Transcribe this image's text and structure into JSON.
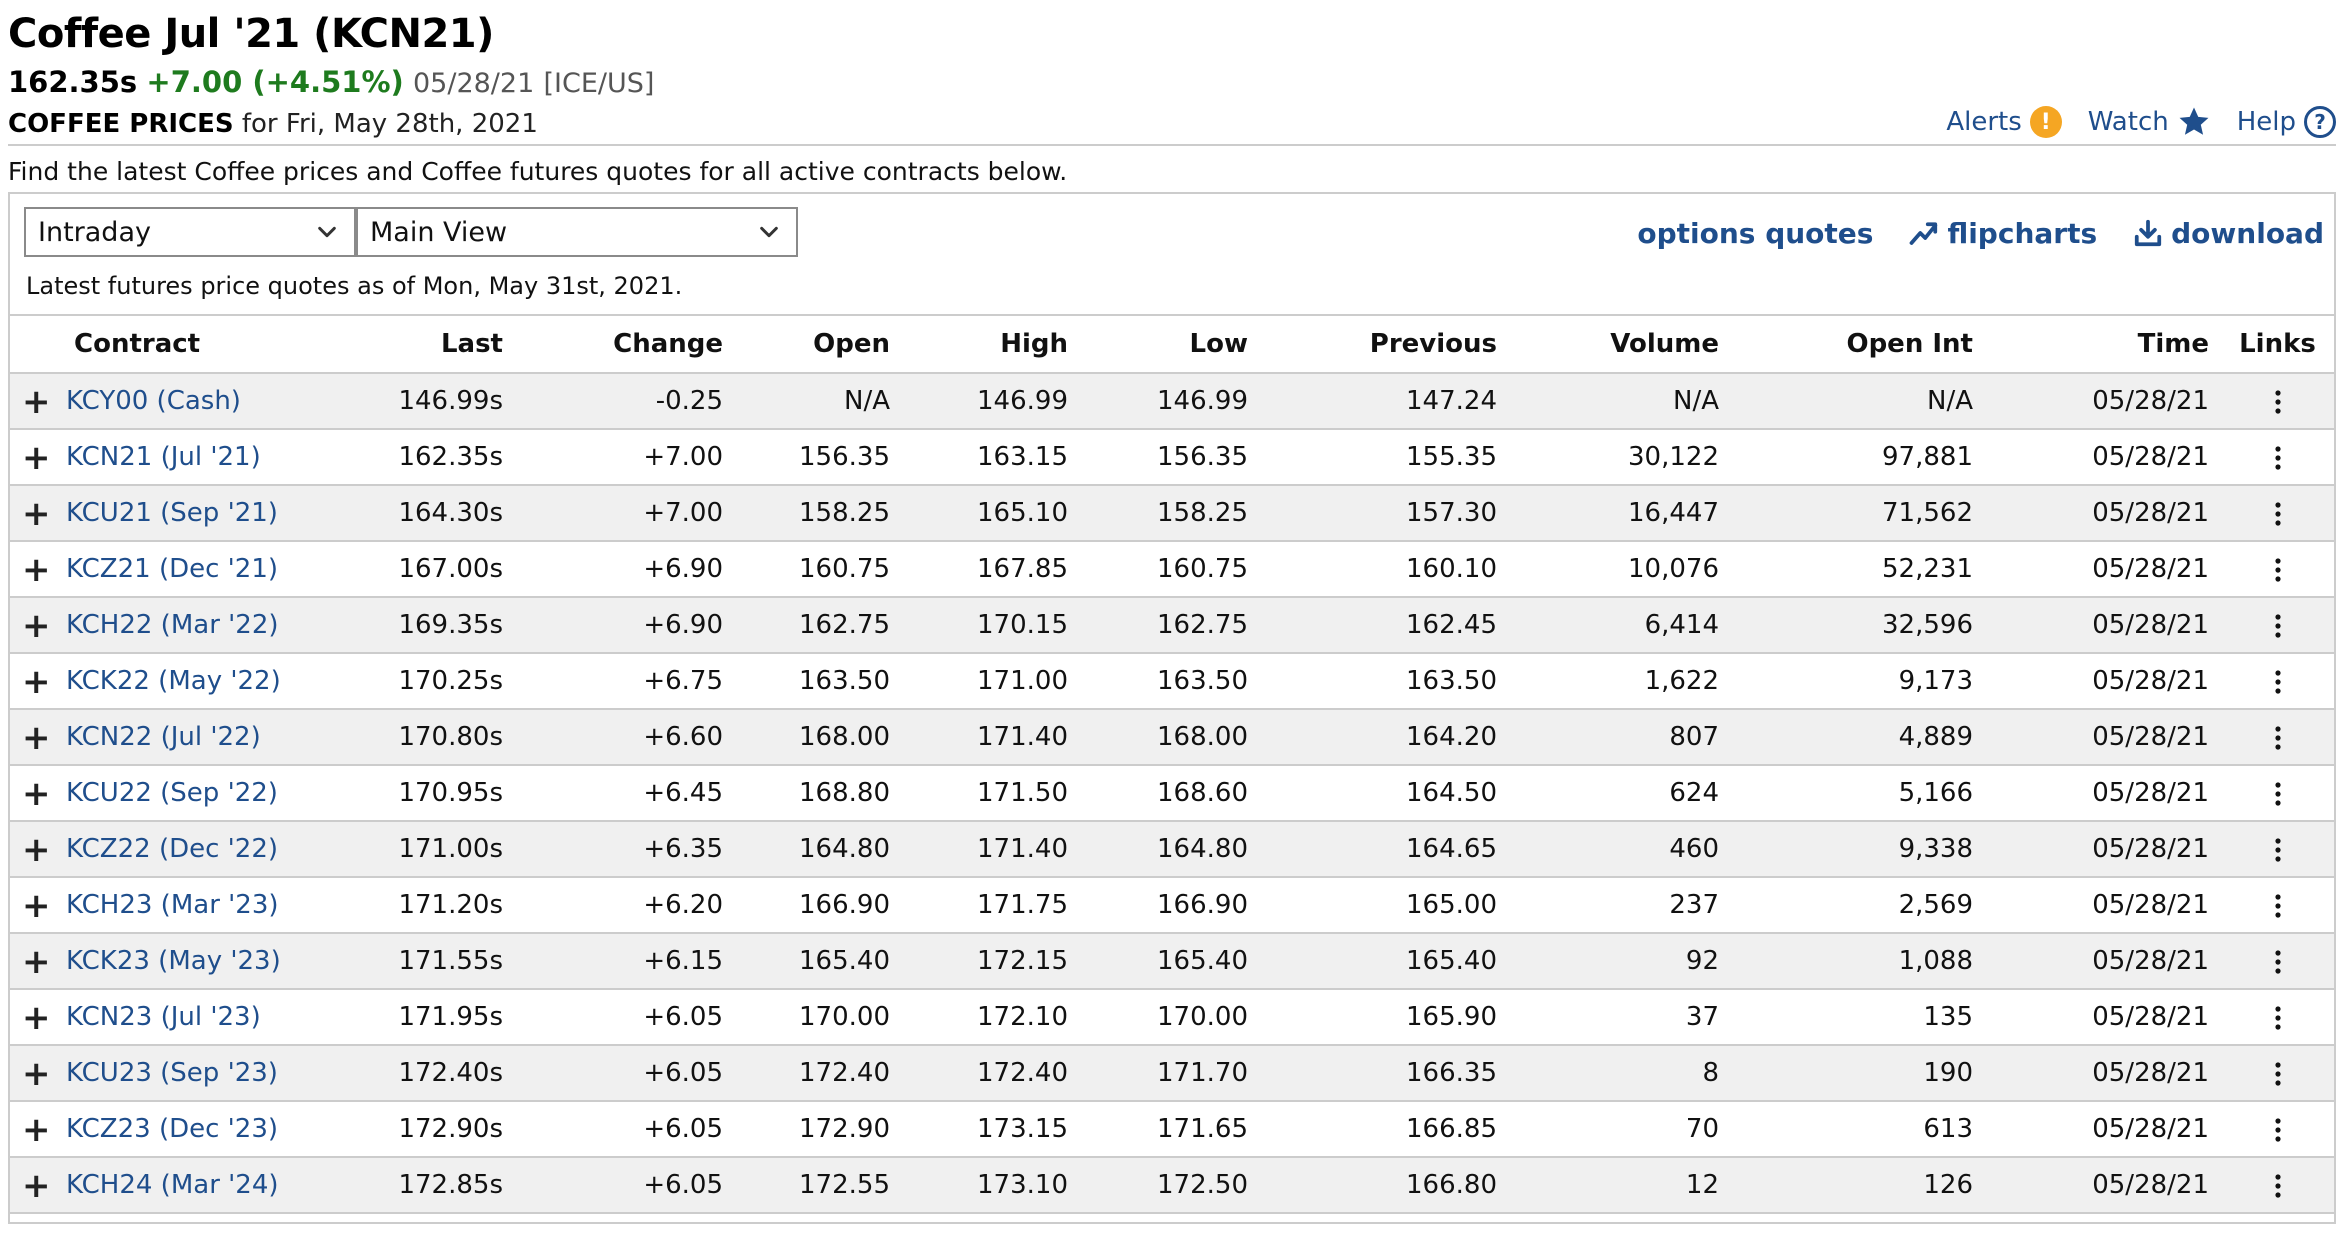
{
  "header": {
    "title": "Coffee Jul '21 (KCN21)",
    "last": "162.35s",
    "change": "+7.00 (+4.51%)",
    "date": "05/28/21",
    "exchange": "[ICE/US]",
    "subtitle_label": "COFFEE PRICES",
    "subtitle_rest": "for Fri, May 28th, 2021"
  },
  "top_links": {
    "alerts": "Alerts",
    "alerts_badge": "!",
    "watch": "Watch",
    "help": "Help",
    "help_glyph": "?"
  },
  "intro": "Find the latest Coffee prices and Coffee futures quotes for all active contracts below.",
  "controls": {
    "period": "Intraday",
    "view": "Main View"
  },
  "tools": {
    "options": "options quotes",
    "flipcharts": "flipcharts",
    "download": "download"
  },
  "as_of": "Latest futures price quotes as of Mon, May 31st, 2021.",
  "table": {
    "columns": [
      "Contract",
      "Last",
      "Change",
      "Open",
      "High",
      "Low",
      "Previous",
      "Volume",
      "Open Int",
      "Time",
      "Links"
    ],
    "rows": [
      {
        "contract": "KCY00 (Cash)",
        "last": "146.99s",
        "change": "-0.25",
        "dir": "neg",
        "open": "N/A",
        "high": "146.99",
        "low": "146.99",
        "previous": "147.24",
        "volume": "N/A",
        "open_int": "N/A",
        "time": "05/28/21"
      },
      {
        "contract": "KCN21 (Jul '21)",
        "last": "162.35s",
        "change": "+7.00",
        "dir": "pos",
        "open": "156.35",
        "high": "163.15",
        "low": "156.35",
        "previous": "155.35",
        "volume": "30,122",
        "open_int": "97,881",
        "time": "05/28/21"
      },
      {
        "contract": "KCU21 (Sep '21)",
        "last": "164.30s",
        "change": "+7.00",
        "dir": "pos",
        "open": "158.25",
        "high": "165.10",
        "low": "158.25",
        "previous": "157.30",
        "volume": "16,447",
        "open_int": "71,562",
        "time": "05/28/21"
      },
      {
        "contract": "KCZ21 (Dec '21)",
        "last": "167.00s",
        "change": "+6.90",
        "dir": "pos",
        "open": "160.75",
        "high": "167.85",
        "low": "160.75",
        "previous": "160.10",
        "volume": "10,076",
        "open_int": "52,231",
        "time": "05/28/21"
      },
      {
        "contract": "KCH22 (Mar '22)",
        "last": "169.35s",
        "change": "+6.90",
        "dir": "pos",
        "open": "162.75",
        "high": "170.15",
        "low": "162.75",
        "previous": "162.45",
        "volume": "6,414",
        "open_int": "32,596",
        "time": "05/28/21"
      },
      {
        "contract": "KCK22 (May '22)",
        "last": "170.25s",
        "change": "+6.75",
        "dir": "pos",
        "open": "163.50",
        "high": "171.00",
        "low": "163.50",
        "previous": "163.50",
        "volume": "1,622",
        "open_int": "9,173",
        "time": "05/28/21"
      },
      {
        "contract": "KCN22 (Jul '22)",
        "last": "170.80s",
        "change": "+6.60",
        "dir": "pos",
        "open": "168.00",
        "high": "171.40",
        "low": "168.00",
        "previous": "164.20",
        "volume": "807",
        "open_int": "4,889",
        "time": "05/28/21"
      },
      {
        "contract": "KCU22 (Sep '22)",
        "last": "170.95s",
        "change": "+6.45",
        "dir": "pos",
        "open": "168.80",
        "high": "171.50",
        "low": "168.60",
        "previous": "164.50",
        "volume": "624",
        "open_int": "5,166",
        "time": "05/28/21"
      },
      {
        "contract": "KCZ22 (Dec '22)",
        "last": "171.00s",
        "change": "+6.35",
        "dir": "pos",
        "open": "164.80",
        "high": "171.40",
        "low": "164.80",
        "previous": "164.65",
        "volume": "460",
        "open_int": "9,338",
        "time": "05/28/21"
      },
      {
        "contract": "KCH23 (Mar '23)",
        "last": "171.20s",
        "change": "+6.20",
        "dir": "pos",
        "open": "166.90",
        "high": "171.75",
        "low": "166.90",
        "previous": "165.00",
        "volume": "237",
        "open_int": "2,569",
        "time": "05/28/21"
      },
      {
        "contract": "KCK23 (May '23)",
        "last": "171.55s",
        "change": "+6.15",
        "dir": "pos",
        "open": "165.40",
        "high": "172.15",
        "low": "165.40",
        "previous": "165.40",
        "volume": "92",
        "open_int": "1,088",
        "time": "05/28/21"
      },
      {
        "contract": "KCN23 (Jul '23)",
        "last": "171.95s",
        "change": "+6.05",
        "dir": "pos",
        "open": "170.00",
        "high": "172.10",
        "low": "170.00",
        "previous": "165.90",
        "volume": "37",
        "open_int": "135",
        "time": "05/28/21"
      },
      {
        "contract": "KCU23 (Sep '23)",
        "last": "172.40s",
        "change": "+6.05",
        "dir": "pos",
        "open": "172.40",
        "high": "172.40",
        "low": "171.70",
        "previous": "166.35",
        "volume": "8",
        "open_int": "190",
        "time": "05/28/21"
      },
      {
        "contract": "KCZ23 (Dec '23)",
        "last": "172.90s",
        "change": "+6.05",
        "dir": "pos",
        "open": "172.90",
        "high": "173.15",
        "low": "171.65",
        "previous": "166.85",
        "volume": "70",
        "open_int": "613",
        "time": "05/28/21"
      },
      {
        "contract": "KCH24 (Mar '24)",
        "last": "172.85s",
        "change": "+6.05",
        "dir": "pos",
        "open": "172.55",
        "high": "173.10",
        "low": "172.50",
        "previous": "166.80",
        "volume": "12",
        "open_int": "126",
        "time": "05/28/21"
      }
    ]
  },
  "icons": {
    "expand": "plus-icon",
    "row_menu": "kebab-menu-icon",
    "select_chevron": "chevron-down-icon",
    "flipcharts": "trend-chart-icon",
    "download": "download-icon",
    "watch": "star-icon",
    "alerts": "alert-icon",
    "help": "help-icon"
  },
  "colors": {
    "link": "#1f4e8c",
    "positive": "#1e7b1e",
    "negative": "#c0392b",
    "alert": "#f5a623",
    "zebra": "#f0f0f0"
  }
}
